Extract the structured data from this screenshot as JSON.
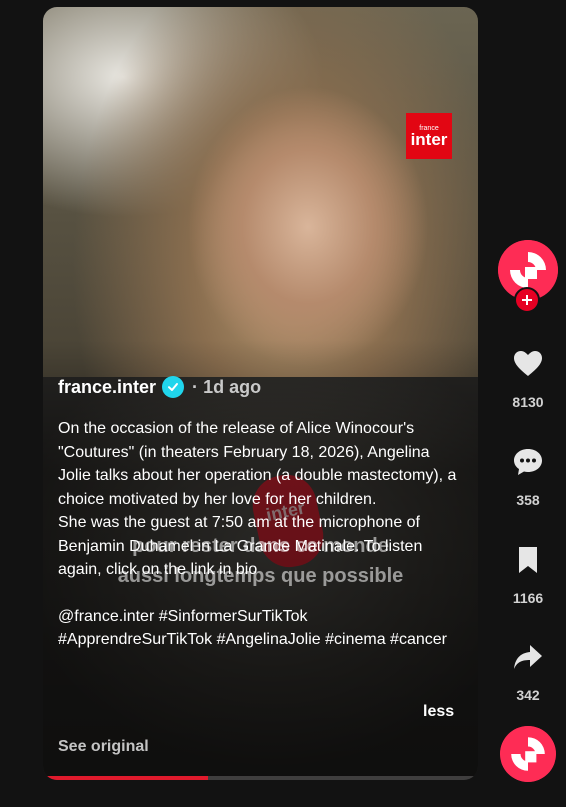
{
  "video": {
    "channel_logo_small": "france",
    "channel_logo_big": "inter",
    "mic_label": "inter",
    "subtitle_line1": "pour rester dans ce monde",
    "subtitle_line2": "aussi longtemps que possible",
    "progress": 0.38
  },
  "post": {
    "author": "france.inter",
    "separator": "·",
    "age": "1d ago",
    "caption_line1": "On the occasion of the release of Alice Winocour's \"Coutures\" (in theaters February 18, 2026), Angelina Jolie talks about her operation (a double mastectomy), a choice motivated by her love for her children.",
    "caption_line2": "She was the guest at 7:50 am at the microphone of Benjamin Duhamel in La Grande Matinale. To listen again, click on the link in bio",
    "hashtags": "@france.inter #SinformerSurTikTok #ApprendreSurTikTok #AngelinaJolie #cinema #cancer",
    "less_label": "less",
    "see_original_label": "See original"
  },
  "actions": {
    "likes": "8130",
    "comments": "358",
    "saves": "1166",
    "shares": "342"
  },
  "colors": {
    "accent": "#fe2c55",
    "verified": "#20d5ec",
    "follow": "#e60023"
  },
  "icons": {
    "verified": "check-badge-icon",
    "follow": "plus-icon",
    "like": "heart-icon",
    "comment": "comment-bubble-icon",
    "save": "bookmark-icon",
    "share": "share-arrow-icon"
  }
}
